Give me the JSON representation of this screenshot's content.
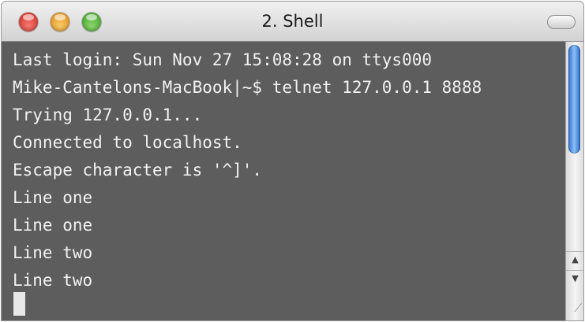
{
  "window": {
    "title": "2. Shell"
  },
  "colors": {
    "terminal_background": "#5d5d5d",
    "terminal_text": "#f2f2f2",
    "close": "#d0261c",
    "minimize": "#e08a10",
    "zoom": "#3c9e22",
    "scroll_thumb": "#2f6fd0"
  },
  "icons": {
    "close": "close-icon",
    "minimize": "minimize-icon",
    "zoom": "zoom-icon",
    "toolbar_toggle": "toolbar-toggle-icon",
    "scroll_up": "▲",
    "scroll_down": "▼",
    "resize_grip": "resize-grip-icon"
  },
  "terminal": {
    "lines": [
      "Last login: Sun Nov 27 15:08:28 on ttys000",
      "Mike-Cantelons-MacBook|~$ telnet 127.0.0.1 8888",
      "Trying 127.0.0.1...",
      "Connected to localhost.",
      "Escape character is '^]'.",
      "Line one",
      "Line one",
      "Line two",
      "Line two"
    ]
  }
}
